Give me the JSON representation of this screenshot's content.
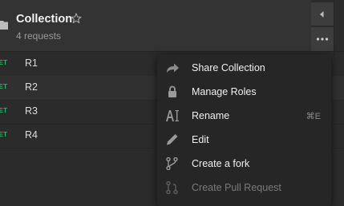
{
  "collection": {
    "title": "Collection",
    "subtitle": "4 requests"
  },
  "requests": [
    {
      "method": "GET",
      "name": "R1"
    },
    {
      "method": "GET",
      "name": "R2"
    },
    {
      "method": "GET",
      "name": "R3"
    },
    {
      "method": "GET",
      "name": "R4"
    }
  ],
  "menu": {
    "items": [
      {
        "label": "Share Collection",
        "icon": "share-arrow-icon",
        "shortcut": ""
      },
      {
        "label": "Manage Roles",
        "icon": "lock-icon",
        "shortcut": ""
      },
      {
        "label": "Rename",
        "icon": "rename-icon",
        "shortcut": "⌘E"
      },
      {
        "label": "Edit",
        "icon": "pencil-icon",
        "shortcut": ""
      },
      {
        "label": "Create a fork",
        "icon": "fork-icon",
        "shortcut": ""
      },
      {
        "label": "Create Pull Request",
        "icon": "pull-request-icon",
        "shortcut": "",
        "disabled": true
      }
    ]
  },
  "colors": {
    "background": "#2b2b2b",
    "header": "#333333",
    "menu": "#262626",
    "method_get": "#2eb36a"
  }
}
